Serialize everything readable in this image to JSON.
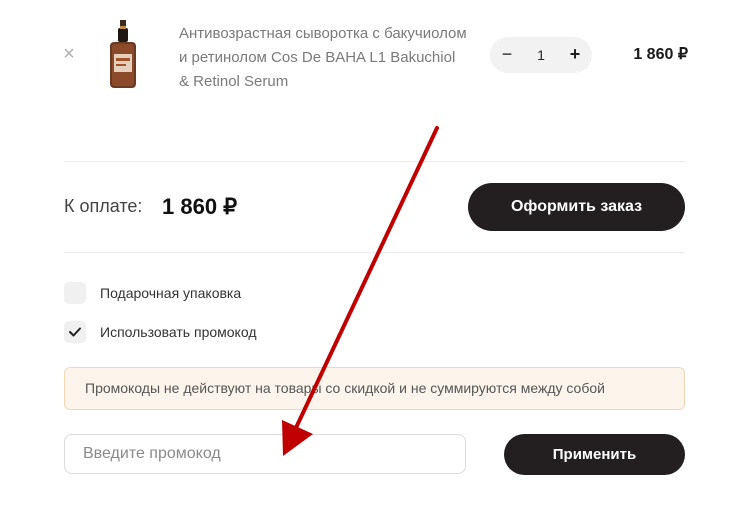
{
  "cart_item": {
    "remove_icon": "close-icon",
    "name": "Антивозрастная сыворотка с бакучиолом и ретинолом Cos De BAHA L1 Bakuchiol & Retinol Serum",
    "quantity": "1",
    "minus_label": "−",
    "plus_label": "+",
    "price": "1 860 ₽"
  },
  "summary": {
    "total_label": "К оплате:",
    "total_value": "1 860 ₽",
    "checkout_label": "Оформить заказ"
  },
  "options": [
    {
      "label": "Подарочная упаковка",
      "checked": false
    },
    {
      "label": "Использовать промокод",
      "checked": true
    }
  ],
  "promo": {
    "notice": "Промокоды не действуют на товары со скидкой и не суммируются между собой",
    "placeholder": "Введите промокод",
    "value": "",
    "apply_label": "Применить"
  },
  "colors": {
    "primary_button": "#231f20",
    "notice_bg": "#fdf5ec",
    "notice_border": "#f2d7b6",
    "annotation_arrow": "#c00000"
  }
}
